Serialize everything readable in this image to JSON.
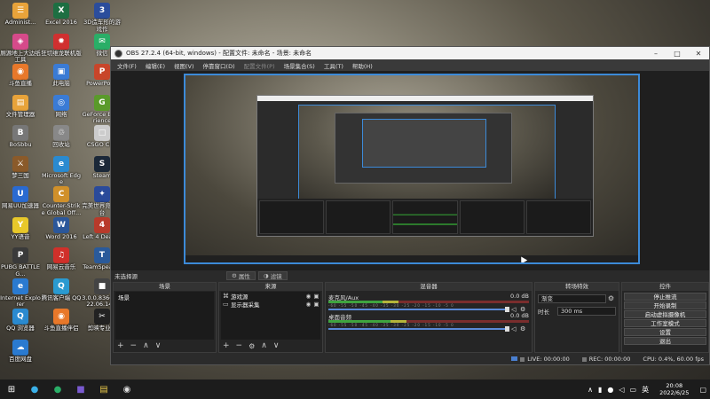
{
  "desktop": {
    "icons": [
      {
        "label": "Administ...",
        "glyph": "☰",
        "color": "#e8a33a"
      },
      {
        "label": "Excel 2016",
        "glyph": "X",
        "color": "#1d6f42"
      },
      {
        "label": "3D造车形的游戏作",
        "glyph": "3",
        "color": "#2b4d9c"
      },
      {
        "label": "厕源地上大边纸工具",
        "glyph": "◈",
        "color": "#d64a8a"
      },
      {
        "label": "狂切维龙联机版",
        "glyph": "✹",
        "color": "#d03030"
      },
      {
        "label": "微信",
        "glyph": "✉",
        "color": "#2aae67"
      },
      {
        "label": "斗鱼直播",
        "glyph": "◉",
        "color": "#e8782a"
      },
      {
        "label": "此电脑",
        "glyph": "▣",
        "color": "#3a7bd5"
      },
      {
        "label": "PowerPoint",
        "glyph": "P",
        "color": "#c8452a"
      },
      {
        "label": "文件管理器",
        "glyph": "▤",
        "color": "#e8a33a"
      },
      {
        "label": "网络",
        "glyph": "◎",
        "color": "#3a7bd5"
      },
      {
        "label": "GeForce Experience",
        "glyph": "G",
        "color": "#5a9a2a"
      },
      {
        "label": "BoSbbu",
        "glyph": "B",
        "color": "#777777"
      },
      {
        "label": "回收站",
        "glyph": "♲",
        "color": "#888888"
      },
      {
        "label": "CSGO CFG",
        "glyph": "□",
        "color": "#cccccc"
      },
      {
        "label": "梦三国",
        "glyph": "⚔",
        "color": "#8a5a2a"
      },
      {
        "label": "Microsoft Edge",
        "glyph": "e",
        "color": "#2a8ad0"
      },
      {
        "label": "Steam",
        "glyph": "S",
        "color": "#1b2838"
      },
      {
        "label": "网易UU加速器",
        "glyph": "U",
        "color": "#2a6ad0"
      },
      {
        "label": "Counter-Strike Global Off...",
        "glyph": "C",
        "color": "#d0902a"
      },
      {
        "label": "完美世界竞技平台",
        "glyph": "✦",
        "color": "#2a4a9a"
      },
      {
        "label": "YY语音",
        "glyph": "Y",
        "color": "#e8c82a"
      },
      {
        "label": "Word 2016",
        "glyph": "W",
        "color": "#2b579a"
      },
      {
        "label": "Left 4 Dead 2",
        "glyph": "4",
        "color": "#b83a2a"
      },
      {
        "label": "PUBG BATTLEG...",
        "glyph": "P",
        "color": "#3a3a3a"
      },
      {
        "label": "网易云音乐",
        "glyph": "♫",
        "color": "#d0302a"
      },
      {
        "label": "TeamSpeak 3",
        "glyph": "T",
        "color": "#2a5a9a"
      },
      {
        "label": "Internet Explorer",
        "glyph": "e",
        "color": "#2a7ad0"
      },
      {
        "label": "腾讯客户端 QQ",
        "glyph": "Q",
        "color": "#2a9ad0"
      },
      {
        "label": "3.0.0.8366 2022.06.14...",
        "glyph": "■",
        "color": "#444444"
      },
      {
        "label": "QQ 浏览器",
        "glyph": "Q",
        "color": "#2a8ad0"
      },
      {
        "label": "斗鱼直播伴侣",
        "glyph": "◉",
        "color": "#e8782a"
      },
      {
        "label": "剪映专业版",
        "glyph": "✂",
        "color": "#222222"
      },
      {
        "label": "百度网盘",
        "glyph": "☁",
        "color": "#2a7ad0"
      }
    ]
  },
  "obs": {
    "title": "OBS 27.2.4 (64-bit, windows) - 配置文件: 未命名 - 场景: 未命名",
    "menu": [
      "文件(F)",
      "编辑(E)",
      "视图(V)",
      "停靠窗口(D)",
      "配置文件(P)",
      "场景集合(S)",
      "工具(T)",
      "帮助(H)"
    ],
    "menu_dim_index": 4,
    "source_bar": {
      "current": "未选择源",
      "properties": "属性",
      "filters": "滤镜"
    },
    "scenes": {
      "header": "场景",
      "items": [
        "场景"
      ]
    },
    "sources": {
      "header": "来源",
      "items": [
        {
          "icon": "game-controller",
          "glyph": "⌘",
          "name": "游戏源"
        },
        {
          "icon": "monitor",
          "glyph": "▭",
          "name": "显示器采集"
        }
      ]
    },
    "mixer": {
      "header": "混音器",
      "channels": [
        {
          "name": "麦克风/Aux",
          "db": "0.0 dB",
          "level": 0.27
        },
        {
          "name": "桌面音频",
          "db": "0.0 dB",
          "level": 0.31
        }
      ],
      "ticks": "-60 -55 -50 -45 -40 -35 -30 -25 -20 -15 -10 -5 0"
    },
    "transitions": {
      "header": "转场特效",
      "type": "渐变",
      "duration_label": "时长",
      "duration_value": "300 ms"
    },
    "controls": {
      "header": "控件",
      "buttons": [
        "停止推流",
        "开始录制",
        "启动虚拟摄像机",
        "工作室模式",
        "设置",
        "退出"
      ]
    },
    "status": {
      "live": "LIVE: 00:00:00",
      "rec": "REC: 00:00:00",
      "cpu": "CPU: 0.4%, 60.00 fps"
    }
  },
  "taskbar": {
    "time": "20:08",
    "date": "2022/6/25",
    "lang": "英"
  }
}
